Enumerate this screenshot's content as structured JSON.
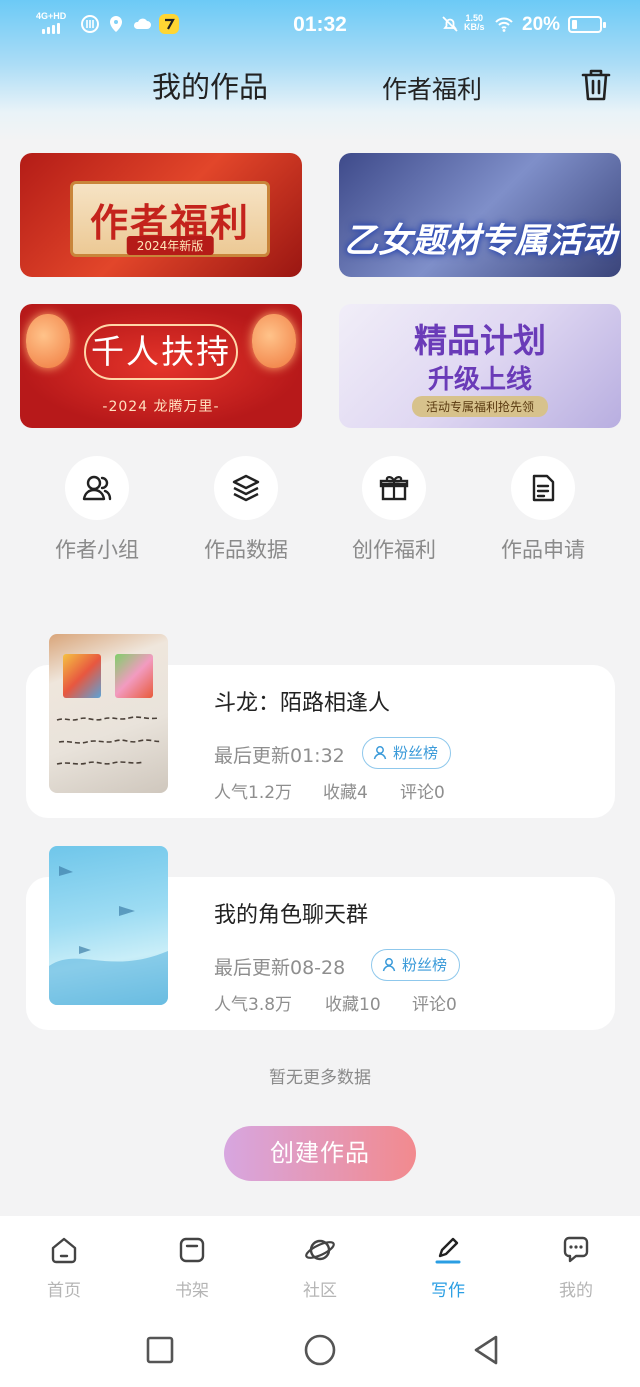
{
  "status_bar": {
    "network": "4G+HD",
    "time": "01:32",
    "net_speed_value": "1.50",
    "net_speed_unit": "KB/s",
    "battery": "20%",
    "battery_level": 0.2
  },
  "header": {
    "tab_works": "我的作品",
    "tab_benefits": "作者福利",
    "trash_icon": "trash-icon"
  },
  "banners": [
    {
      "title": "作者福利",
      "subtitle": "2024年新版"
    },
    {
      "title": "乙女题材专属活动"
    },
    {
      "title": "千人扶持",
      "subtitle": "-2024 龙腾万里-"
    },
    {
      "title": "精品计划",
      "title2": "升级上线",
      "subtitle": "活动专属福利抢先领"
    }
  ],
  "quick_actions": [
    {
      "label": "作者小组",
      "icon": "group-icon"
    },
    {
      "label": "作品数据",
      "icon": "layers-icon"
    },
    {
      "label": "创作福利",
      "icon": "gift-icon"
    },
    {
      "label": "作品申请",
      "icon": "document-icon"
    }
  ],
  "works": [
    {
      "title": "斗龙：陌路相逢人",
      "updated": "最后更新01:32",
      "fans_label": "粉丝榜",
      "popularity": "人气1.2万",
      "favorites": "收藏4",
      "comments": "评论0"
    },
    {
      "title": "我的角色聊天群",
      "updated": "最后更新08-28",
      "fans_label": "粉丝榜",
      "popularity": "人气3.8万",
      "favorites": "收藏10",
      "comments": "评论0"
    }
  ],
  "no_more": "暂无更多数据",
  "create_button": "创建作品",
  "bottom_nav": [
    {
      "label": "首页",
      "icon": "home-icon"
    },
    {
      "label": "书架",
      "icon": "bookshelf-icon"
    },
    {
      "label": "社区",
      "icon": "planet-icon"
    },
    {
      "label": "写作",
      "icon": "pen-icon",
      "active": true
    },
    {
      "label": "我的",
      "icon": "chat-bubble-icon"
    }
  ],
  "colors": {
    "accent": "#2a9ee3",
    "header_gradient_top": "#6ccaf6",
    "create_gradient_start": "#d7a6e0",
    "create_gradient_end": "#f28a8e"
  }
}
